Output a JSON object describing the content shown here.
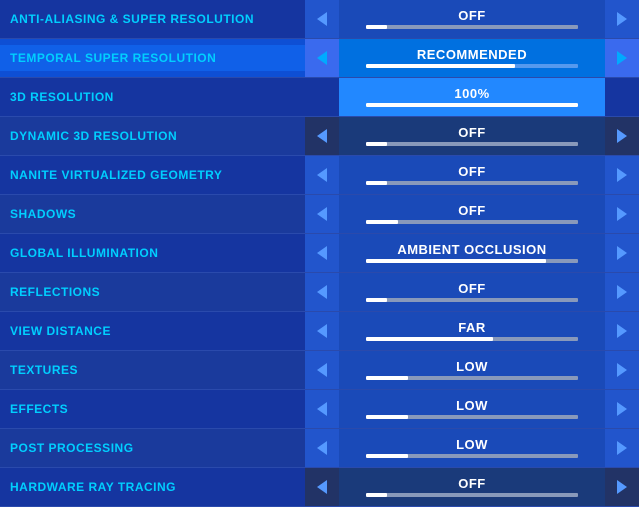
{
  "settings": [
    {
      "id": "anti-aliasing",
      "label": "ANTI-ALIASING & SUPER RESOLUTION",
      "value": "OFF",
      "barFill": 10,
      "style": "normal"
    },
    {
      "id": "temporal-super-resolution",
      "label": "TEMPORAL SUPER RESOLUTION",
      "value": "RECOMMENDED",
      "barFill": 70,
      "style": "highlighted"
    },
    {
      "id": "3d-resolution",
      "label": "3D RESOLUTION",
      "value": "100%",
      "barFill": 100,
      "style": "bright"
    },
    {
      "id": "dynamic-3d-resolution",
      "label": "DYNAMIC 3D RESOLUTION",
      "value": "OFF",
      "barFill": 10,
      "style": "dark-arrow dark-value"
    },
    {
      "id": "nanite",
      "label": "NANITE VIRTUALIZED GEOMETRY",
      "value": "OFF",
      "barFill": 10,
      "style": "normal"
    },
    {
      "id": "shadows",
      "label": "SHADOWS",
      "value": "OFF",
      "barFill": 15,
      "style": "normal"
    },
    {
      "id": "global-illumination",
      "label": "GLOBAL ILLUMINATION",
      "value": "AMBIENT OCCLUSION",
      "barFill": 85,
      "style": "normal"
    },
    {
      "id": "reflections",
      "label": "REFLECTIONS",
      "value": "OFF",
      "barFill": 10,
      "style": "normal"
    },
    {
      "id": "view-distance",
      "label": "VIEW DISTANCE",
      "value": "FAR",
      "barFill": 60,
      "style": "normal"
    },
    {
      "id": "textures",
      "label": "TEXTURES",
      "value": "LOW",
      "barFill": 20,
      "style": "normal"
    },
    {
      "id": "effects",
      "label": "EFFECTS",
      "value": "LOW",
      "barFill": 20,
      "style": "normal"
    },
    {
      "id": "post-processing",
      "label": "POST PROCESSING",
      "value": "LOW",
      "barFill": 20,
      "style": "normal"
    },
    {
      "id": "hardware-ray-tracing",
      "label": "HARDWARE RAY TRACING",
      "value": "OFF",
      "barFill": 10,
      "style": "dark-arrow dark-value"
    }
  ]
}
